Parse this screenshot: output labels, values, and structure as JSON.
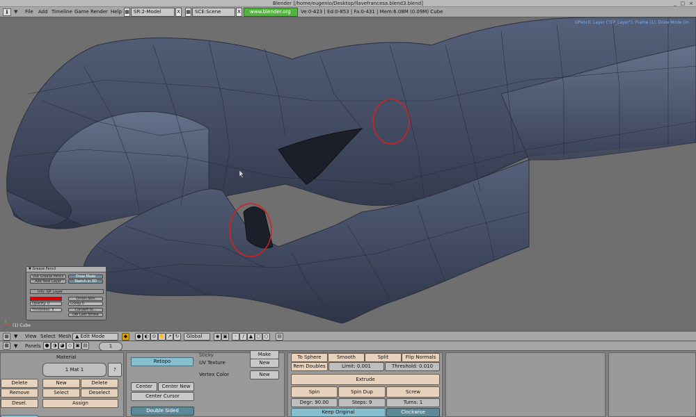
{
  "window": {
    "title": "Blender [/home/eugenio/Desktop/llavefrancesa.blend3.blend]",
    "controls": [
      "_",
      "□",
      "×"
    ]
  },
  "info_header": {
    "editor_icon": "i",
    "menus": [
      "File",
      "Add",
      "Timeline",
      "Game",
      "Render",
      "Help"
    ],
    "screen": "SR:2-Model",
    "scene": "SCE:Scene",
    "link": "www.blender.org 249.2",
    "stats": "Ve:0-423 | Ed:0-853 | Fa:0-431 | Mem:6.08M (0.09M) Cube",
    "close_glyph": "X"
  },
  "viewport": {
    "info_text": "GPencil: Layer (\"GP_Layer\"), Frame (1), Draw Mode On",
    "object_label": "(1) Cube"
  },
  "grease_pencil": {
    "title": "Grease Pencil",
    "use_btn": "Use Grease Pencil",
    "add_layer_btn": "Add New Layer",
    "draw_mode_btn": "Draw Mode",
    "sketch_btn": "Sketch in 3D",
    "layer_name": "Info: GP_Layer",
    "onion_btn": "Onion-Skin",
    "opacity": "Opacity: 0",
    "gstep": "GStep:0",
    "thickness": "Thickness: 3",
    "convert_btn": "Convert to...",
    "del_stroke_btn": "Del Last Stroke"
  },
  "view3d_header": {
    "menus": [
      "View",
      "Select",
      "Mesh"
    ],
    "mode": "Edit Mode",
    "orientation": "Global"
  },
  "buttons_header": {
    "panels_label": "Panels",
    "frame": "1"
  },
  "link_materials": {
    "material_label": "Material",
    "mat_slot": "1 Mat 1",
    "help": "?",
    "delete_left": "Delete",
    "remove": "Remove",
    "desel": "Desel.",
    "new": "New",
    "delete": "Delete",
    "select": "Select",
    "deselect": "Deselect",
    "assign": "Assign"
  },
  "mesh_panel": {
    "retopo": "Retopo",
    "center": "Center",
    "center_new": "Center New",
    "center_cursor": "Center Cursor",
    "double_sided": "Double Sided",
    "sticky": "Sticky",
    "uv_texture": "UV Texture",
    "vertex_color": "Vertex Color",
    "new1": "New",
    "new2": "New",
    "new3": "Make"
  },
  "mesh_tools": {
    "to_sphere": "To Sphere",
    "smooth": "Smooth",
    "split": "Split",
    "flip_normals": "Flip Normals",
    "rem_doubles": "Rem Doubles",
    "limit": "Limit: 0.001",
    "threshold": "Threshold: 0.010",
    "extrude": "Extrude",
    "spin": "Spin",
    "spin_dup": "Spin Dup",
    "screw": "Screw",
    "degr": "Degr: 90.00",
    "steps": "Steps: 9",
    "turns": "Turns: 1",
    "keep_original": "Keep Original",
    "clockwise": "Clockwise"
  }
}
